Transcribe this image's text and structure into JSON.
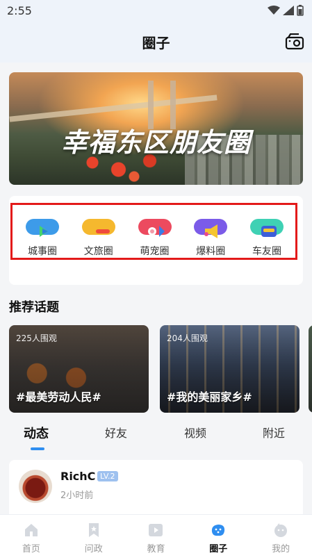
{
  "status_bar": {
    "time": "2:55"
  },
  "header": {
    "title": "圈子",
    "camera_icon": "camera-icon"
  },
  "banner": {
    "title": "幸福东区朋友圈"
  },
  "circles": [
    {
      "label": "城事圈",
      "icon": "city-circle-icon",
      "color": "#3d9be9"
    },
    {
      "label": "文旅圈",
      "icon": "travel-circle-icon",
      "color": "#f5b82e"
    },
    {
      "label": "萌宠圈",
      "icon": "pet-circle-icon",
      "color": "#ec4a5f"
    },
    {
      "label": "爆料圈",
      "icon": "megaphone-icon",
      "color": "#7b5be8"
    },
    {
      "label": "车友圈",
      "icon": "car-circle-icon",
      "color": "#3fd1b4"
    }
  ],
  "section": {
    "recommended_topics": "推荐话题"
  },
  "topics": [
    {
      "viewers": "225人围观",
      "name": "#最美劳动人民#"
    },
    {
      "viewers": "204人围观",
      "name": "#我的美丽家乡#"
    }
  ],
  "tabs": [
    "动态",
    "好友",
    "视频",
    "附近"
  ],
  "post": {
    "username": "RichC",
    "level": "LV.2",
    "time": "2小时前"
  },
  "bottom_nav": [
    {
      "label": "首页",
      "icon": "home-icon"
    },
    {
      "label": "问政",
      "icon": "bookmark-star-icon"
    },
    {
      "label": "教育",
      "icon": "play-icon"
    },
    {
      "label": "圈子",
      "icon": "circle-blob-icon"
    },
    {
      "label": "我的",
      "icon": "profile-icon"
    }
  ],
  "colors": {
    "accent": "#2f8ef0",
    "highlight_border": "#e31a1a"
  }
}
